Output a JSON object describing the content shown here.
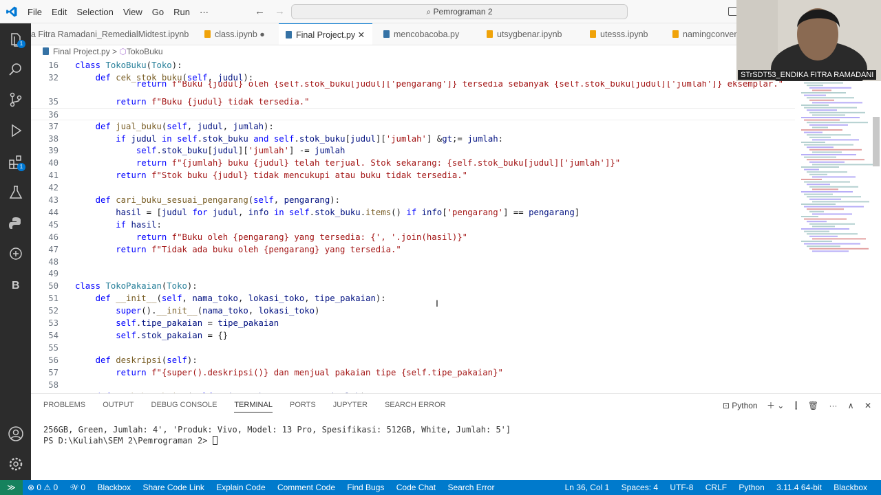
{
  "menu": [
    "File",
    "Edit",
    "Selection",
    "View",
    "Go",
    "Run",
    "···"
  ],
  "search": {
    "text": "Pemrograman 2"
  },
  "tabs": [
    {
      "label": "a Fitra Ramadani_RemedialMidtest.ipynb",
      "color": "#f0a30a"
    },
    {
      "label": "class.ipynb ●",
      "color": "#f0a30a"
    },
    {
      "label": "Final Project.py ✕",
      "color": "#3572a5",
      "active": true
    },
    {
      "label": "mencobacoba.py",
      "color": "#3572a5"
    },
    {
      "label": "utsygbenar.ipynb",
      "color": "#f0a30a"
    },
    {
      "label": "utesss.ipynb",
      "color": "#f0a30a"
    },
    {
      "label": "namingconver",
      "color": "#f0a30a"
    }
  ],
  "breadcrumb": {
    "file": "Final Project.py",
    "sep": ">",
    "symbol": "TokoBuku"
  },
  "lines": [
    {
      "n": "16",
      "t": "class TokoBuku(Toko):"
    },
    {
      "n": "32",
      "t": "    def cek_stok_buku(self, judul):"
    },
    {
      "n": "",
      "t": "            return f\"Buku {judul} oleh {self.stok_buku[judul]['pengarang']} tersedia sebanyak {self.stok_buku[judul]['jumlah']} eksemplar.\""
    },
    {
      "n": "35",
      "t": "        return f\"Buku {judul} tidak tersedia.\""
    },
    {
      "n": "36",
      "t": ""
    },
    {
      "n": "37",
      "t": "    def jual_buku(self, judul, jumlah):"
    },
    {
      "n": "38",
      "t": "        if judul in self.stok_buku and self.stok_buku[judul]['jumlah'] >= jumlah:"
    },
    {
      "n": "39",
      "t": "            self.stok_buku[judul]['jumlah'] -= jumlah"
    },
    {
      "n": "40",
      "t": "            return f\"{jumlah} buku {judul} telah terjual. Stok sekarang: {self.stok_buku[judul]['jumlah']}\""
    },
    {
      "n": "41",
      "t": "        return f\"Stok buku {judul} tidak mencukupi atau buku tidak tersedia.\""
    },
    {
      "n": "42",
      "t": ""
    },
    {
      "n": "43",
      "t": "    def cari_buku_sesuai_pengarang(self, pengarang):"
    },
    {
      "n": "44",
      "t": "        hasil = [judul for judul, info in self.stok_buku.items() if info['pengarang'] == pengarang]"
    },
    {
      "n": "45",
      "t": "        if hasil:"
    },
    {
      "n": "46",
      "t": "            return f\"Buku oleh {pengarang} yang tersedia: {', '.join(hasil)}\""
    },
    {
      "n": "47",
      "t": "        return f\"Tidak ada buku oleh {pengarang} yang tersedia.\""
    },
    {
      "n": "48",
      "t": ""
    },
    {
      "n": "49",
      "t": ""
    },
    {
      "n": "50",
      "t": "class TokoPakaian(Toko):"
    },
    {
      "n": "51",
      "t": "    def __init__(self, nama_toko, lokasi_toko, tipe_pakaian):"
    },
    {
      "n": "52",
      "t": "        super().__init__(nama_toko, lokasi_toko)"
    },
    {
      "n": "53",
      "t": "        self.tipe_pakaian = tipe_pakaian"
    },
    {
      "n": "54",
      "t": "        self.stok_pakaian = {}"
    },
    {
      "n": "55",
      "t": ""
    },
    {
      "n": "56",
      "t": "    def deskripsi(self):"
    },
    {
      "n": "57",
      "t": "        return f\"{super().deskripsi()} dan menjual pakaian tipe {self.tipe_pakaian}\""
    },
    {
      "n": "58",
      "t": ""
    },
    {
      "n": "59",
      "t": "    def tambah_pakaian(self, tipe, ukuran, warna, jumlah):"
    }
  ],
  "panel": {
    "tabs": [
      "PROBLEMS",
      "OUTPUT",
      "DEBUG CONSOLE",
      "TERMINAL",
      "PORTS",
      "JUPYTER",
      "SEARCH ERROR"
    ],
    "active": "TERMINAL",
    "shell": "Python",
    "terminal": [
      "256GB, Green, Jumlah: 4', 'Produk: Vivo, Model: 13 Pro, Spesifikasi: 512GB, White, Jumlah: 5']",
      "PS D:\\Kuliah\\SEM 2\\Pemrograman 2> "
    ]
  },
  "status": {
    "left": [
      "⊗ 0 ⚠ 0",
      "𝒲 0",
      "Blackbox",
      "Share Code Link",
      "Explain Code",
      "Comment Code",
      "Find Bugs",
      "Code Chat",
      "Search Error"
    ],
    "right": [
      "Ln 36, Col 1",
      "Spaces: 4",
      "UTF-8",
      "CRLF",
      "Python",
      "3.11.4 64-bit",
      "Blackbox"
    ]
  },
  "webcam": {
    "label": "STrSDT53_ENDIKA FITRA RAMADANI"
  },
  "colors": {
    "accent": "#007acc",
    "activity": "#2c2c2c",
    "remote": "#16825d"
  }
}
